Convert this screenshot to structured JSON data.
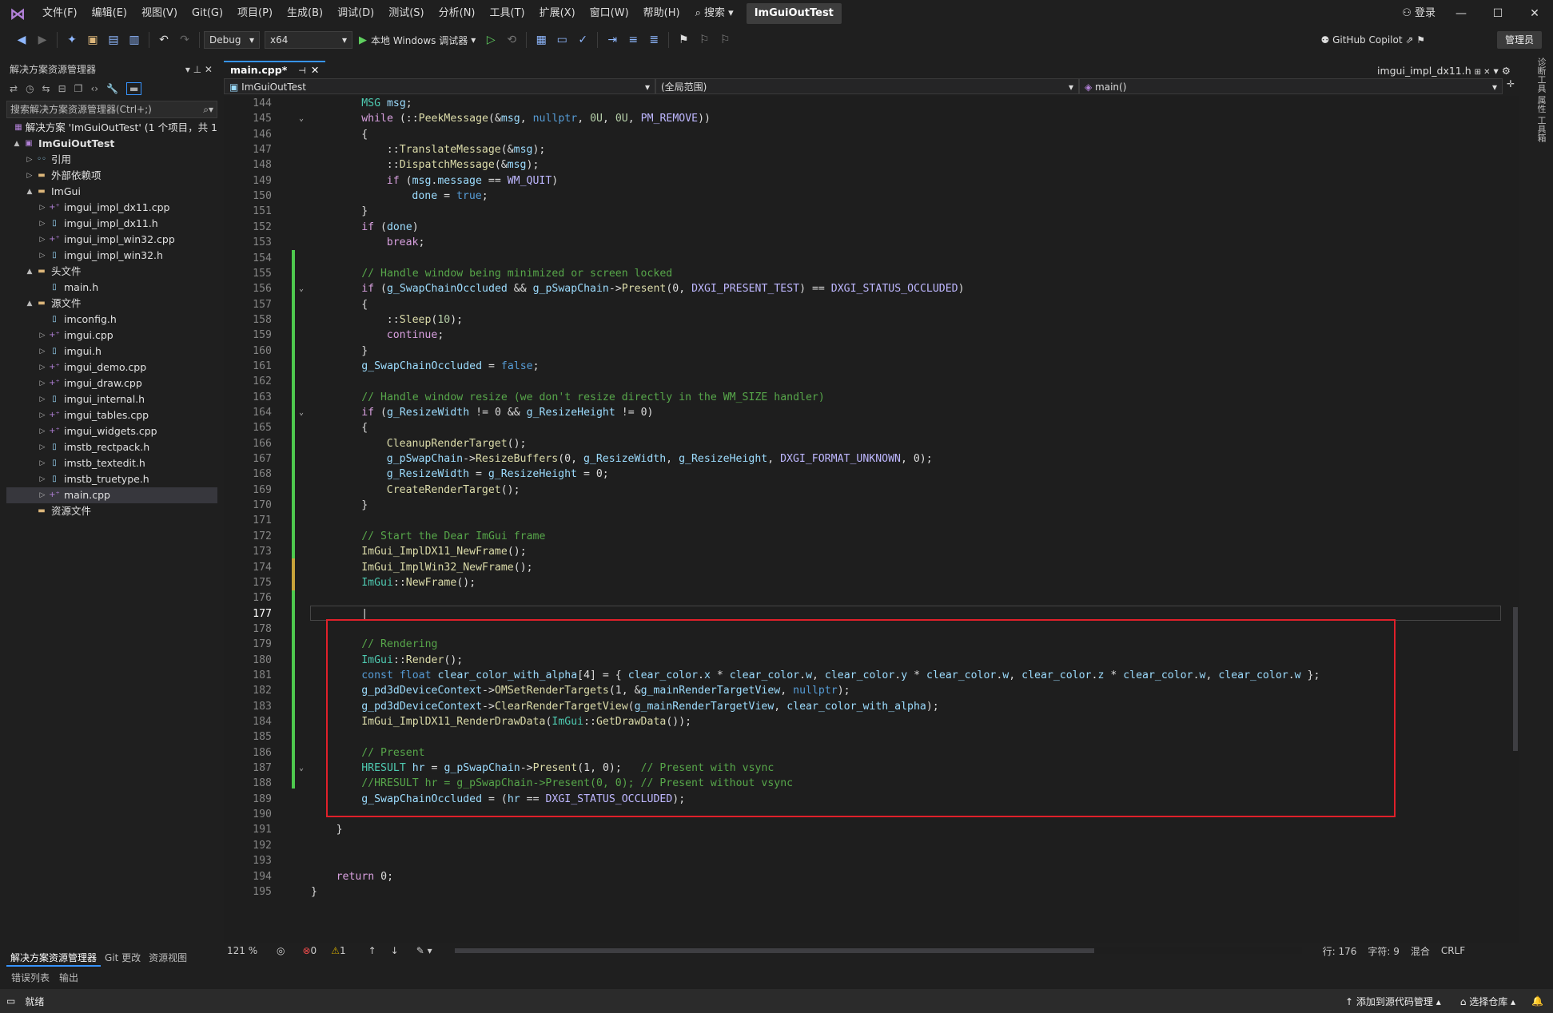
{
  "titlebar": {
    "menus": [
      "文件(F)",
      "编辑(E)",
      "视图(V)",
      "Git(G)",
      "项目(P)",
      "生成(B)",
      "调试(D)",
      "测试(S)",
      "分析(N)",
      "工具(T)",
      "扩展(X)",
      "窗口(W)",
      "帮助(H)"
    ],
    "search": "搜索",
    "solution_name": "ImGuiOutTest",
    "login": "登录"
  },
  "toolbar": {
    "config": "Debug",
    "platform": "x64",
    "run_label": "本地 Windows 调试器",
    "copilot": "GitHub Copilot",
    "admin": "管理员"
  },
  "solution_explorer": {
    "title": "解决方案资源管理器",
    "search_placeholder": "搜索解决方案资源管理器(Ctrl+;)",
    "items": [
      {
        "label": "解决方案 'ImGuiOutTest' (1 个项目，共 1",
        "indent": 0,
        "caret": "",
        "icon": "solution",
        "bold": false
      },
      {
        "label": "ImGuiOutTest",
        "indent": 0,
        "caret": "▲",
        "icon": "project",
        "bold": true
      },
      {
        "label": "引用",
        "indent": 1,
        "caret": "▷",
        "icon": "ref",
        "bold": false
      },
      {
        "label": "外部依赖项",
        "indent": 1,
        "caret": "▷",
        "icon": "folder",
        "bold": false
      },
      {
        "label": "ImGui",
        "indent": 1,
        "caret": "▲",
        "icon": "folder",
        "bold": false
      },
      {
        "label": "imgui_impl_dx11.cpp",
        "indent": 2,
        "caret": "▷",
        "icon": "cpp",
        "bold": false
      },
      {
        "label": "imgui_impl_dx11.h",
        "indent": 2,
        "caret": "▷",
        "icon": "h",
        "bold": false
      },
      {
        "label": "imgui_impl_win32.cpp",
        "indent": 2,
        "caret": "▷",
        "icon": "cpp",
        "bold": false
      },
      {
        "label": "imgui_impl_win32.h",
        "indent": 2,
        "caret": "▷",
        "icon": "h",
        "bold": false
      },
      {
        "label": "头文件",
        "indent": 1,
        "caret": "▲",
        "icon": "folder",
        "bold": false
      },
      {
        "label": "main.h",
        "indent": 2,
        "caret": "",
        "icon": "h",
        "bold": false
      },
      {
        "label": "源文件",
        "indent": 1,
        "caret": "▲",
        "icon": "folder",
        "bold": false
      },
      {
        "label": "imconfig.h",
        "indent": 2,
        "caret": "",
        "icon": "h",
        "bold": false
      },
      {
        "label": "imgui.cpp",
        "indent": 2,
        "caret": "▷",
        "icon": "cpp",
        "bold": false
      },
      {
        "label": "imgui.h",
        "indent": 2,
        "caret": "▷",
        "icon": "h",
        "bold": false
      },
      {
        "label": "imgui_demo.cpp",
        "indent": 2,
        "caret": "▷",
        "icon": "cpp",
        "bold": false
      },
      {
        "label": "imgui_draw.cpp",
        "indent": 2,
        "caret": "▷",
        "icon": "cpp",
        "bold": false
      },
      {
        "label": "imgui_internal.h",
        "indent": 2,
        "caret": "▷",
        "icon": "h",
        "bold": false
      },
      {
        "label": "imgui_tables.cpp",
        "indent": 2,
        "caret": "▷",
        "icon": "cpp",
        "bold": false
      },
      {
        "label": "imgui_widgets.cpp",
        "indent": 2,
        "caret": "▷",
        "icon": "cpp",
        "bold": false
      },
      {
        "label": "imstb_rectpack.h",
        "indent": 2,
        "caret": "▷",
        "icon": "h",
        "bold": false
      },
      {
        "label": "imstb_textedit.h",
        "indent": 2,
        "caret": "▷",
        "icon": "h",
        "bold": false
      },
      {
        "label": "imstb_truetype.h",
        "indent": 2,
        "caret": "▷",
        "icon": "h",
        "bold": false
      },
      {
        "label": "main.cpp",
        "indent": 2,
        "caret": "▷",
        "icon": "cpp",
        "bold": false,
        "selected": true
      },
      {
        "label": "资源文件",
        "indent": 1,
        "caret": "",
        "icon": "folder",
        "bold": false
      }
    ],
    "bottom_tabs": [
      "解决方案资源管理器",
      "Git 更改",
      "资源视图"
    ]
  },
  "editor": {
    "active_tab": "main.cpp*",
    "right_tab": "imgui_impl_dx11.h",
    "nav_project": "ImGuiOutTest",
    "nav_scope": "(全局范围)",
    "nav_member": "main()",
    "zoom": "121 %",
    "errors": "0",
    "warnings": "1",
    "line": "行: 176",
    "char": "字符: 9",
    "mix": "混合",
    "eol": "CRLF",
    "first_line": 144,
    "current_line": 177
  },
  "bottom": {
    "tabs": [
      "错误列表",
      "输出"
    ],
    "status": "就绪",
    "add_source": "添加到源代码管理",
    "select_repo": "选择仓库"
  },
  "right_vertical": "诊断工具 属性 工具箱"
}
